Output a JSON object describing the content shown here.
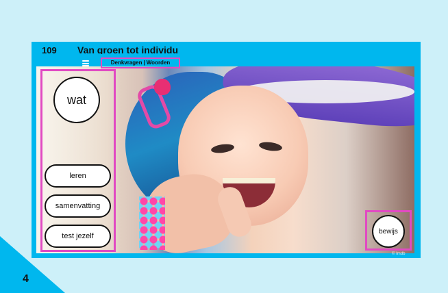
{
  "header": {
    "lesson_number": "109",
    "lesson_title": "Van groen tot individu",
    "nav": {
      "item_1": "Denkvragen",
      "separator": "|",
      "item_2": "Woorden"
    }
  },
  "left_panel": {
    "primary_circle": "wat",
    "buttons": {
      "leren": "leren",
      "samenvatting": "samenvatting",
      "test": "test jezelf"
    }
  },
  "right_panel": {
    "circle": "bewijs"
  },
  "photo": {
    "credit": "© Imdb"
  },
  "page": {
    "number": "4"
  },
  "colors": {
    "background": "#cdf0f9",
    "accent_blue": "#00b7ee",
    "highlight_pink": "#e14ac2"
  },
  "icons": {
    "menu": "menu-icon"
  }
}
